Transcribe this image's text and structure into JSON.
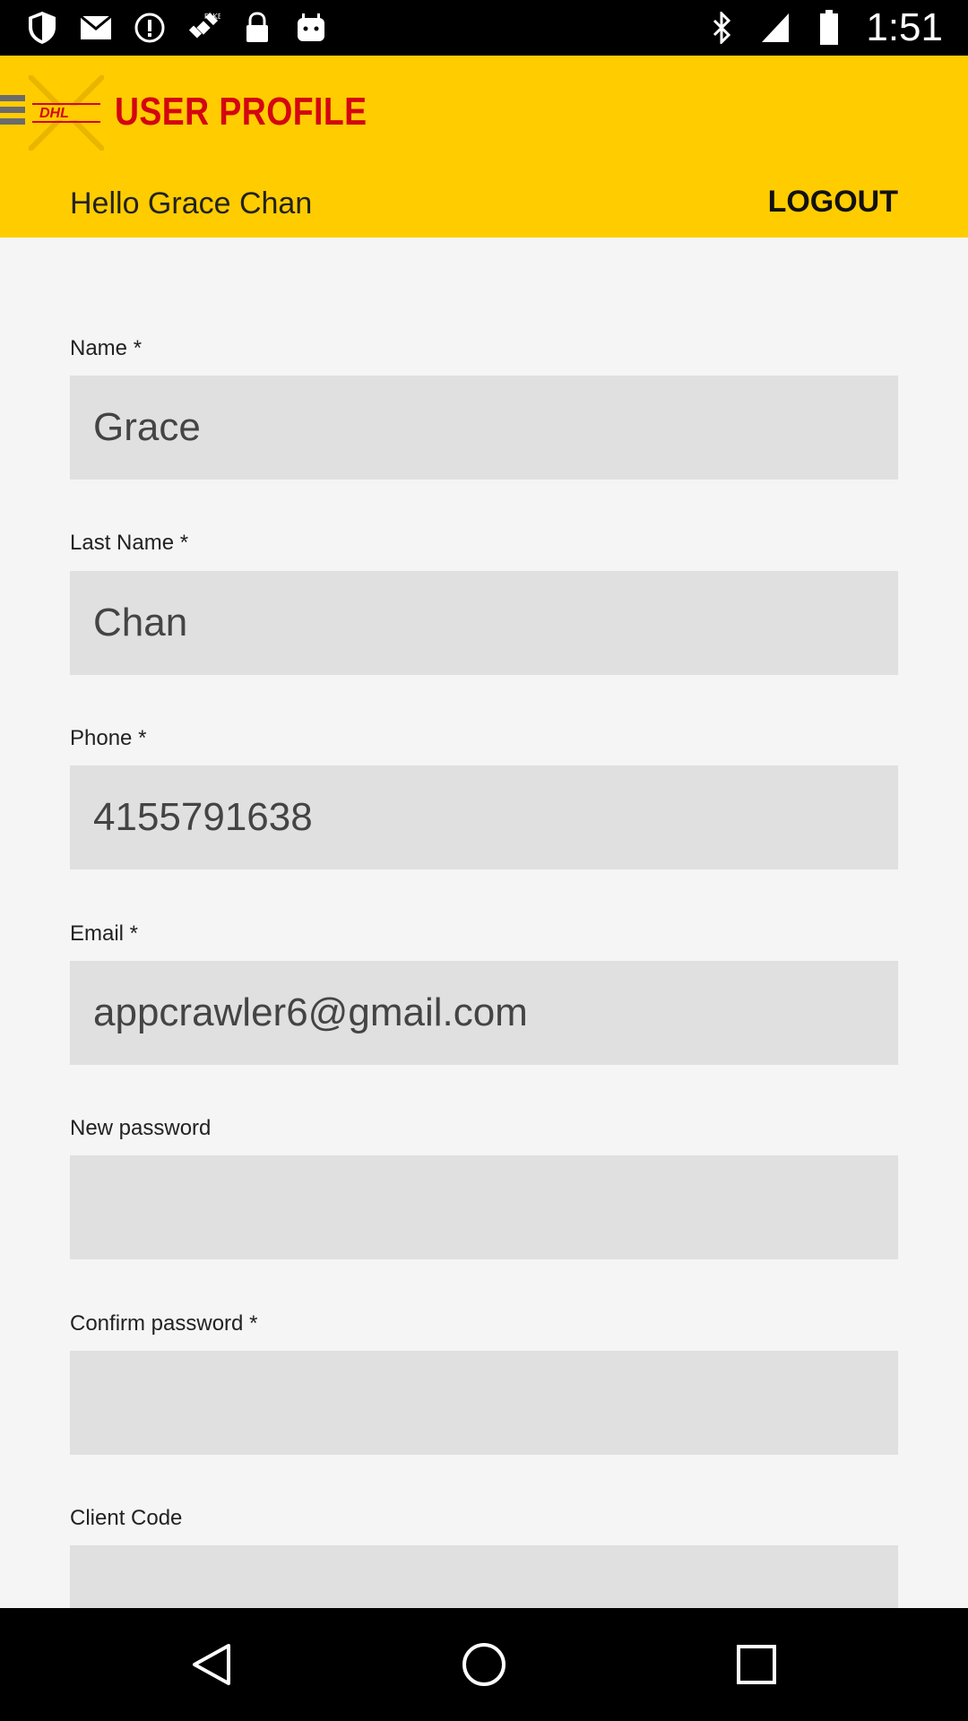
{
  "status_bar": {
    "time": "1:51",
    "icons_left": [
      "shield-icon",
      "mail-icon",
      "alert-icon",
      "satellite-icon",
      "lock-icon",
      "android-icon"
    ],
    "icons_right": [
      "bluetooth-icon",
      "signal-icon",
      "battery-icon"
    ]
  },
  "header": {
    "logo_text": "DHL",
    "title": "USER PROFILE",
    "greeting": "Hello Grace Chan",
    "logout_label": "LOGOUT",
    "colors": {
      "background": "#ffcc00",
      "title": "#d40511"
    }
  },
  "form": {
    "fields": [
      {
        "label": "Name *",
        "value": "Grace"
      },
      {
        "label": "Last Name *",
        "value": "Chan"
      },
      {
        "label": "Phone *",
        "value": "4155791638"
      },
      {
        "label": "Email *",
        "value": "appcrawler6@gmail.com"
      },
      {
        "label": "New password",
        "value": ""
      },
      {
        "label": "Confirm password *",
        "value": ""
      },
      {
        "label": "Client Code",
        "value": ""
      }
    ]
  },
  "nav_bar": {
    "buttons": [
      "back-icon",
      "home-icon",
      "recents-icon"
    ]
  }
}
